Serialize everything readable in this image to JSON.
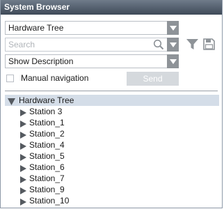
{
  "window": {
    "title": "System Browser"
  },
  "view_selector": {
    "value": "Hardware Tree"
  },
  "search": {
    "placeholder": "Search"
  },
  "description_selector": {
    "value": "Show Description"
  },
  "navigation": {
    "manual_navigation_label": "Manual navigation",
    "manual_navigation_checked": false,
    "send_label": "Send"
  },
  "tree": {
    "root_label": "Hardware Tree",
    "root_expanded": true,
    "items": [
      {
        "label": "Station 3"
      },
      {
        "label": "Station_1"
      },
      {
        "label": "Station_2"
      },
      {
        "label": "Station_4"
      },
      {
        "label": "Station_5"
      },
      {
        "label": "Station_6"
      },
      {
        "label": "Station_7"
      },
      {
        "label": "Station_9"
      },
      {
        "label": "Station_10"
      }
    ]
  },
  "colors": {
    "titlebar": "#4f5a68",
    "tree_root_highlight": "#d4dde8",
    "dropdown_arrow": "#8e9398",
    "send_button": "#d5d9dd"
  }
}
